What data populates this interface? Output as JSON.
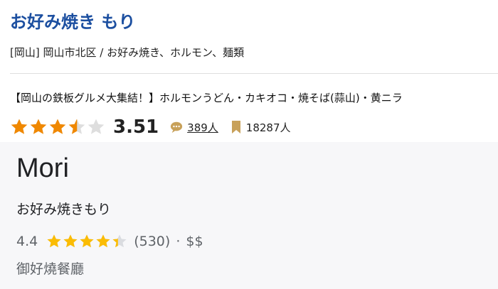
{
  "tabelog": {
    "title": "お好み焼き もり",
    "area_genre": "[岡山] 岡山市北区 / お好み焼き、ホルモン、麺類",
    "catchphrase": "【岡山の鉄板グルメ大集結！】ホルモンうどん・カキオコ・焼そば(蒜山)・黄ニラ",
    "rating": "3.51",
    "rating_value": 3.51,
    "reviews": "389人",
    "bookmarks": "18287人",
    "star_color": "#f08800",
    "icons": [
      "comment-icon",
      "bookmark-icon"
    ]
  },
  "google": {
    "name": "Mori",
    "subtitle": "お好み焼きもり",
    "rating": "4.4",
    "rating_value": 4.4,
    "reviews": "(530)",
    "separator": "·",
    "price": "$$",
    "category": "御好燒餐廳",
    "star_color": "#fbbc04"
  }
}
